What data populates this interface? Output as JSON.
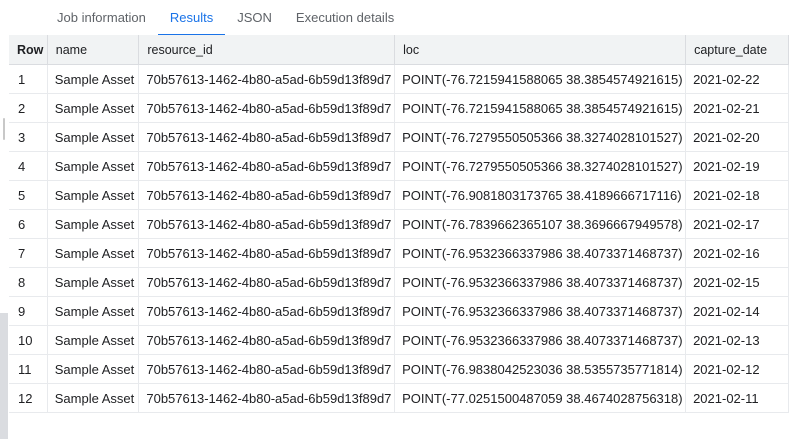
{
  "tabs": [
    {
      "label": "Job information",
      "active": false
    },
    {
      "label": "Results",
      "active": true
    },
    {
      "label": "JSON",
      "active": false
    },
    {
      "label": "Execution details",
      "active": false
    }
  ],
  "table": {
    "headers": {
      "row": "Row",
      "name": "name",
      "resource_id": "resource_id",
      "loc": "loc",
      "capture_date": "capture_date"
    },
    "rows": [
      {
        "row": "1",
        "name": "Sample Asset",
        "resource_id": "70b57613-1462-4b80-a5ad-6b59d13f89d7",
        "loc": "POINT(-76.7215941588065 38.3854574921615)",
        "capture_date": "2021-02-22"
      },
      {
        "row": "2",
        "name": "Sample Asset",
        "resource_id": "70b57613-1462-4b80-a5ad-6b59d13f89d7",
        "loc": "POINT(-76.7215941588065 38.3854574921615)",
        "capture_date": "2021-02-21"
      },
      {
        "row": "3",
        "name": "Sample Asset",
        "resource_id": "70b57613-1462-4b80-a5ad-6b59d13f89d7",
        "loc": "POINT(-76.7279550505366 38.3274028101527)",
        "capture_date": "2021-02-20"
      },
      {
        "row": "4",
        "name": "Sample Asset",
        "resource_id": "70b57613-1462-4b80-a5ad-6b59d13f89d7",
        "loc": "POINT(-76.7279550505366 38.3274028101527)",
        "capture_date": "2021-02-19"
      },
      {
        "row": "5",
        "name": "Sample Asset",
        "resource_id": "70b57613-1462-4b80-a5ad-6b59d13f89d7",
        "loc": "POINT(-76.9081803173765 38.4189666717116)",
        "capture_date": "2021-02-18"
      },
      {
        "row": "6",
        "name": "Sample Asset",
        "resource_id": "70b57613-1462-4b80-a5ad-6b59d13f89d7",
        "loc": "POINT(-76.7839662365107 38.3696667949578)",
        "capture_date": "2021-02-17"
      },
      {
        "row": "7",
        "name": "Sample Asset",
        "resource_id": "70b57613-1462-4b80-a5ad-6b59d13f89d7",
        "loc": "POINT(-76.9532366337986 38.4073371468737)",
        "capture_date": "2021-02-16"
      },
      {
        "row": "8",
        "name": "Sample Asset",
        "resource_id": "70b57613-1462-4b80-a5ad-6b59d13f89d7",
        "loc": "POINT(-76.9532366337986 38.4073371468737)",
        "capture_date": "2021-02-15"
      },
      {
        "row": "9",
        "name": "Sample Asset",
        "resource_id": "70b57613-1462-4b80-a5ad-6b59d13f89d7",
        "loc": "POINT(-76.9532366337986 38.4073371468737)",
        "capture_date": "2021-02-14"
      },
      {
        "row": "10",
        "name": "Sample Asset",
        "resource_id": "70b57613-1462-4b80-a5ad-6b59d13f89d7",
        "loc": "POINT(-76.9532366337986 38.4073371468737)",
        "capture_date": "2021-02-13"
      },
      {
        "row": "11",
        "name": "Sample Asset",
        "resource_id": "70b57613-1462-4b80-a5ad-6b59d13f89d7",
        "loc": "POINT(-76.9838042523036 38.5355735771814)",
        "capture_date": "2021-02-12"
      },
      {
        "row": "12",
        "name": "Sample Asset",
        "resource_id": "70b57613-1462-4b80-a5ad-6b59d13f89d7",
        "loc": "POINT(-77.0251500487059 38.4674028756318)",
        "capture_date": "2021-02-11"
      }
    ]
  },
  "colors": {
    "accent": "#1a73e8",
    "header_bg": "#f1f3f4",
    "grid": "#e8eaed"
  }
}
